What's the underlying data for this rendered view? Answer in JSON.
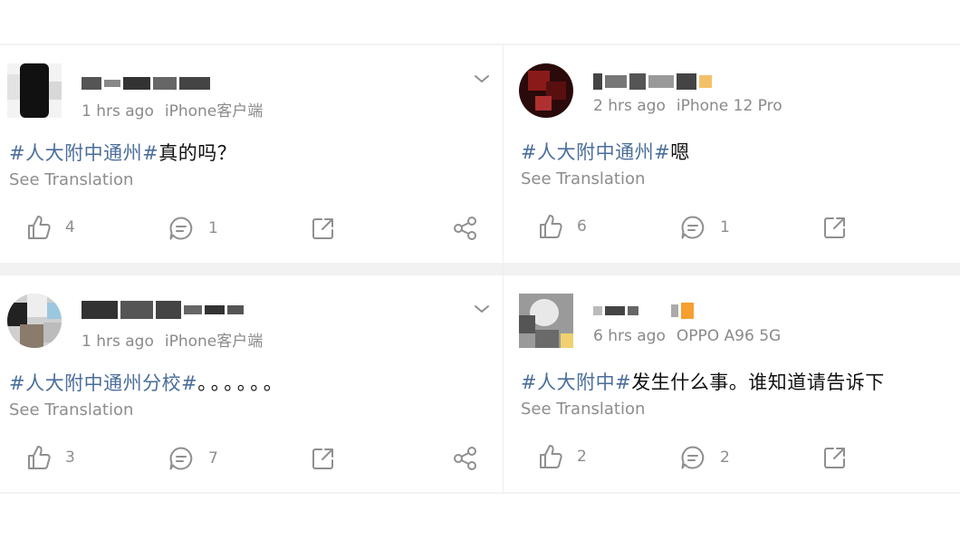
{
  "posts": [
    {
      "time": "1 hrs ago",
      "source": "iPhone客户端",
      "hashtag": "#人大附中通州#",
      "body": "真的吗？",
      "translate": "See Translation",
      "likes": "4",
      "comments": "1",
      "has_menu": true,
      "has_share": true
    },
    {
      "time": "2 hrs ago",
      "source": "iPhone 12 Pro",
      "hashtag": "#人大附中通州#",
      "body": "嗯",
      "translate": "See Translation",
      "likes": "6",
      "comments": "1",
      "has_menu": false,
      "has_share": false
    },
    {
      "time": "1 hrs ago",
      "source": "iPhone客户端",
      "hashtag": "#人大附中通州分校#",
      "body": "。。。。。。",
      "translate": "See Translation",
      "likes": "3",
      "comments": "7",
      "has_menu": true,
      "has_share": true
    },
    {
      "time": "6 hrs ago",
      "source": "OPPO A96 5G",
      "hashtag": "#人大附中#",
      "body": "发生什么事。谁知道请告诉下",
      "translate": "See Translation",
      "likes": "2",
      "comments": "2",
      "has_menu": false,
      "has_share": false
    }
  ],
  "colors": {
    "hashtag": "#4b6e9b",
    "meta": "#8a8a8a",
    "icon": "#8f8f8f",
    "divider": "#f2f2f2"
  },
  "icons": [
    "avatar",
    "chevron-down-icon",
    "thumbs-up-icon",
    "comment-icon",
    "repost-icon",
    "share-icon"
  ]
}
